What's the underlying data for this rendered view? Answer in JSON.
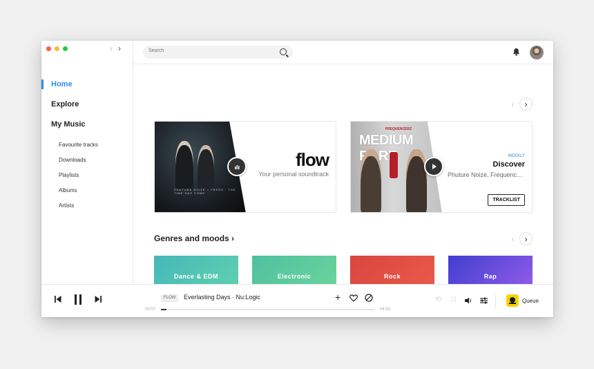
{
  "sidebar": {
    "main_items": [
      {
        "label": "Home",
        "active": true
      },
      {
        "label": "Explore",
        "active": false
      },
      {
        "label": "My Music",
        "active": false
      }
    ],
    "sub_items": [
      {
        "label": "Favourite tracks"
      },
      {
        "label": "Downloads"
      },
      {
        "label": "Playlists"
      },
      {
        "label": "Albums"
      },
      {
        "label": "Artists"
      }
    ]
  },
  "topbar": {
    "search_placeholder": "Search"
  },
  "featured": {
    "flow": {
      "art_caption": "PHUTURE NOIZE × FRESH · THE TIME HAS COME",
      "title": "flow",
      "subtitle": "Your personal soundtrack"
    },
    "discover": {
      "art_logo": "FREQUENCERZ",
      "art_title": "MEDIUM RARE",
      "tag": "WEEKLY",
      "title": "Discover",
      "subtitle": "Phuture Noize, Frequencerz",
      "button": "TRACKLIST"
    }
  },
  "genres": {
    "title": "Genres and moods ›",
    "tiles": [
      {
        "label": "Dance & EDM",
        "color_from": "#45b8b8",
        "color_to": "#5fcfb0"
      },
      {
        "label": "Electronic",
        "color_from": "#4fc0a0",
        "color_to": "#6ad39c"
      },
      {
        "label": "Rock",
        "color_from": "#d9463f",
        "color_to": "#e8594a"
      },
      {
        "label": "Rap",
        "color_from": "#3f3fd0",
        "color_to": "#8f5ae6"
      }
    ]
  },
  "player": {
    "source_tag": "FLOW",
    "track": "Everlasting Days · Nu:Logic",
    "elapsed": "00:07",
    "duration": "04:55",
    "progress_fraction": 0.025,
    "queue_label": "Queue"
  },
  "colors": {
    "accent": "#2f8de4"
  }
}
